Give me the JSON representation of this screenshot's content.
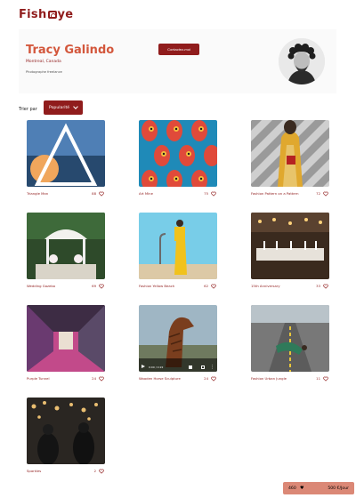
{
  "logo": {
    "prefix": "Fish",
    "suffix": "ye"
  },
  "photographer": {
    "name": "Tracy Galindo",
    "location": "Montreal, Canada",
    "tagline": "Photographe freelance",
    "contact_label": "Contactez-moi"
  },
  "sort": {
    "label": "Trier par",
    "selected": "Popularité"
  },
  "media": [
    {
      "title": "Triangle Man",
      "likes": "88"
    },
    {
      "title": "Art Mine",
      "likes": "75"
    },
    {
      "title": "Fashion Pattern on a Pattern",
      "likes": "72"
    },
    {
      "title": "Wedding Gazebo",
      "likes": "69"
    },
    {
      "title": "Fashion Yellow Beach",
      "likes": "62"
    },
    {
      "title": "15th Anniversary",
      "likes": "33"
    },
    {
      "title": "Purple Tunnel",
      "likes": "24"
    },
    {
      "title": "Wooden Horse Sculpture",
      "likes": "24"
    },
    {
      "title": "Fashion Urban Jungle",
      "likes": "11"
    },
    {
      "title": "Sparkles",
      "likes": "2"
    }
  ],
  "video_controls": {
    "time": "0:00 / 0:22"
  },
  "summary": {
    "total_likes": "460",
    "heart_icon": "♥",
    "price": "500 €/Jour"
  },
  "colors": {
    "brand": "#901c1c",
    "accent": "#d3573c",
    "tag": "#db8876"
  }
}
